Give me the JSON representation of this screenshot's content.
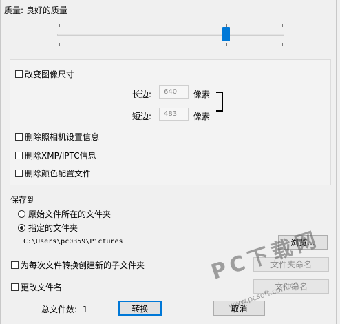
{
  "quality": {
    "label": "质量: 良好的质量",
    "level_percent": 74
  },
  "resize": {
    "checkbox_label": "改变图像尺寸",
    "long_label": "长边:",
    "long_value": "640",
    "short_label": "短边:",
    "short_value": "483",
    "unit": "像素"
  },
  "options": {
    "remove_camera": "删除照相机设置信息",
    "remove_xmp": "删除XMP/IPTC信息",
    "remove_color": "删除颜色配置文件"
  },
  "save": {
    "title": "保存到",
    "original_folder": "原始文件所在的文件夹",
    "specified_folder": "指定的文件夹",
    "path": "C:\\Users\\pc0359\\Pictures",
    "browse_button": "浏览..."
  },
  "subfolder": {
    "checkbox_label": "为每次文件转换创建新的子文件夹",
    "button": "文件夹命名"
  },
  "rename": {
    "checkbox_label": "更改文件名",
    "button": "文件命名"
  },
  "footer": {
    "total_label": "总文件数:",
    "total_count": "1",
    "convert_button": "转换",
    "cancel_button": "取消"
  },
  "watermark": {
    "text": "PC下载网",
    "url": "www.pcsoft.com.cn"
  }
}
